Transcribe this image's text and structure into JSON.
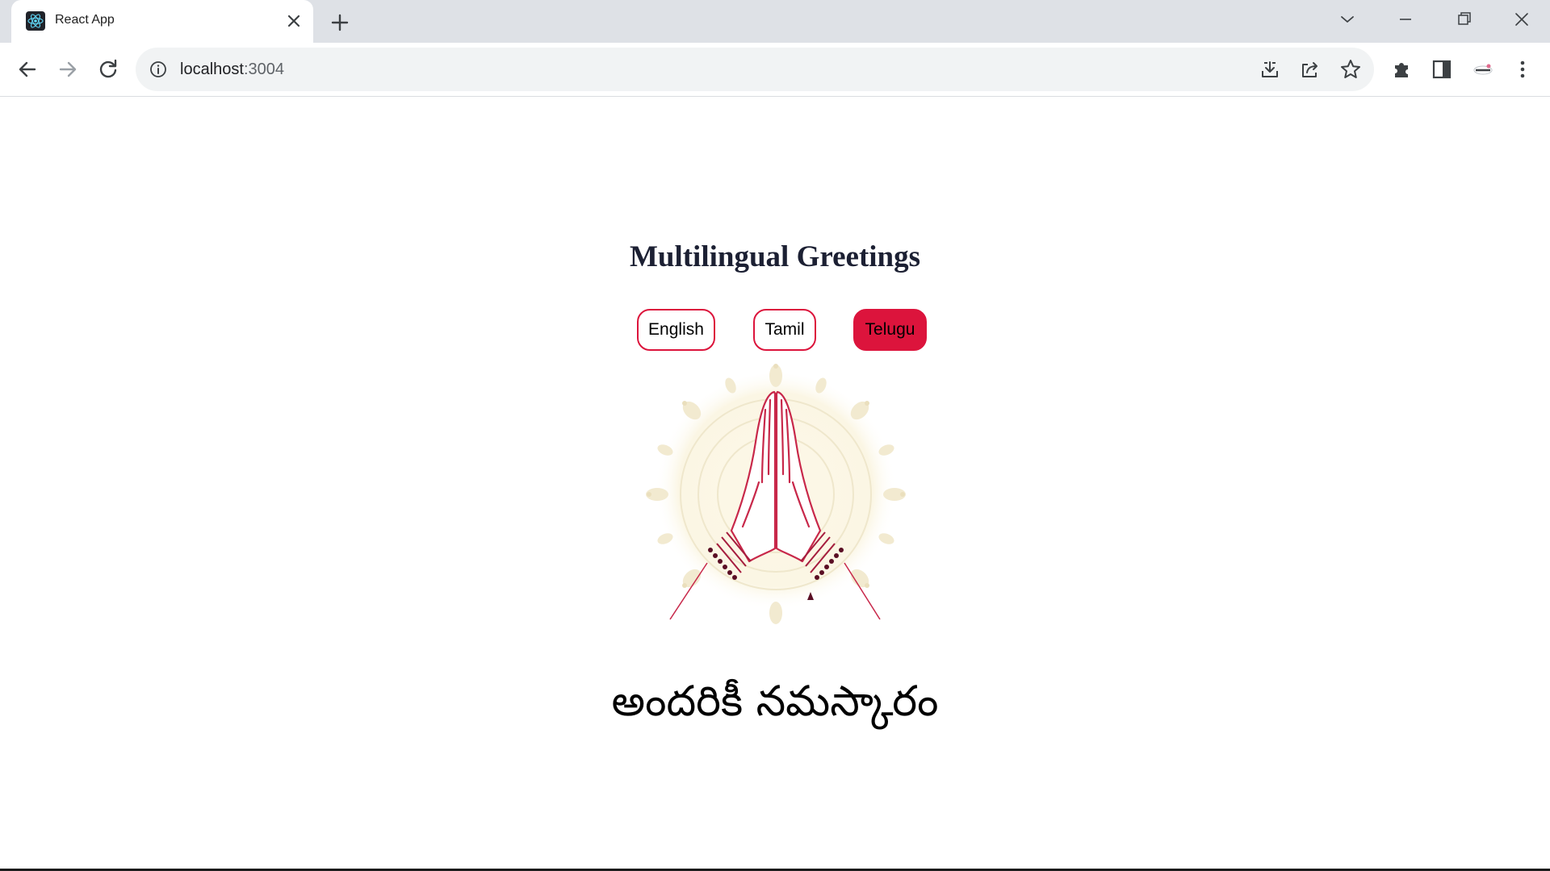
{
  "browser": {
    "tab_title": "React App",
    "url_host": "localhost",
    "url_port": ":3004"
  },
  "page": {
    "heading": "Multilingual Greetings",
    "languages": [
      {
        "label": "English",
        "active": false
      },
      {
        "label": "Tamil",
        "active": false
      },
      {
        "label": "Telugu",
        "active": true
      }
    ],
    "image_alt": "namaste hands illustration",
    "greeting": "అందరికీ నమస్కారం"
  },
  "colors": {
    "accent": "#dc143c",
    "heading": "#1c2033",
    "tabstrip": "#dee1e6",
    "omnibox": "#f1f3f4"
  },
  "icons": {
    "favicon": "react-logo-icon",
    "tab_close": "close-icon",
    "new_tab": "plus-icon",
    "back": "arrow-left-icon",
    "forward": "arrow-right-icon",
    "reload": "reload-icon",
    "site_info": "info-icon",
    "install": "install-icon",
    "share": "share-icon",
    "bookmark": "star-icon",
    "extensions": "puzzle-icon",
    "side_panel": "side-panel-icon",
    "profile": "profile-avatar-icon",
    "menu": "kebab-menu-icon"
  }
}
